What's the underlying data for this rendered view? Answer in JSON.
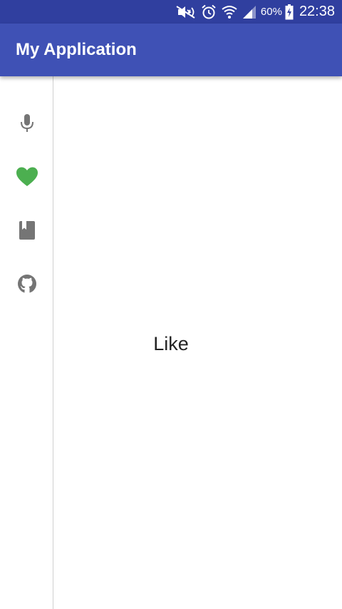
{
  "status_bar": {
    "battery_percent": "60%",
    "time": "22:38",
    "icons": [
      "mute-icon",
      "alarm-icon",
      "wifi-icon",
      "signal-icon",
      "battery-charging-icon"
    ],
    "background_color": "#303f9f"
  },
  "app_bar": {
    "title": "My Application",
    "background_color": "#3f51b5"
  },
  "nav_rail": {
    "items": [
      {
        "icon": "mic-icon",
        "selected": false,
        "color": "#757575"
      },
      {
        "icon": "heart-icon",
        "selected": true,
        "color": "#4caf50"
      },
      {
        "icon": "book-icon",
        "selected": false,
        "color": "#757575"
      },
      {
        "icon": "github-icon",
        "selected": false,
        "color": "#757575"
      }
    ]
  },
  "content": {
    "label": "Like"
  }
}
